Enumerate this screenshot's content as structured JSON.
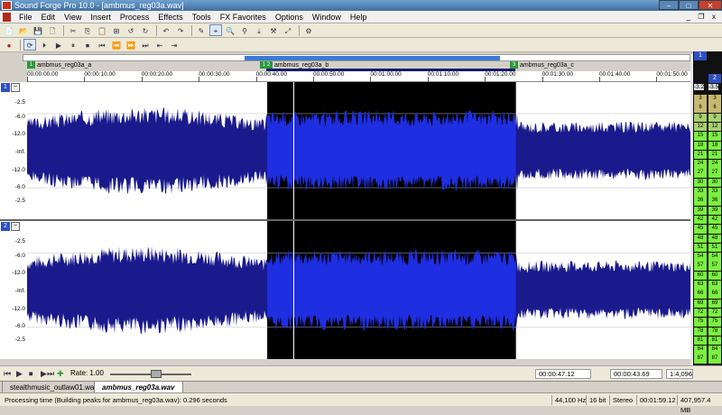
{
  "window": {
    "title": "Sound Forge Pro 10.0 - [ambmus_reg03a.wav]",
    "min": "–",
    "max": "□",
    "close": "✕"
  },
  "menu": [
    "File",
    "Edit",
    "View",
    "Insert",
    "Process",
    "Effects",
    "Tools",
    "FX Favorites",
    "Options",
    "Window",
    "Help"
  ],
  "mdi": {
    "min": "_",
    "restore": "❐",
    "close": "x"
  },
  "toolbar1": [
    "📄",
    "📂",
    "💾",
    "🗋",
    "✂",
    "⎘",
    "📋",
    "⊞",
    "↺",
    "↻",
    "↶",
    "↷",
    "✎",
    "⌖",
    "🔍",
    "⚲",
    "⤓",
    "⚒",
    "⤢",
    "⚙"
  ],
  "toolbar2": [
    "●",
    "⟳",
    "⏵",
    "▶",
    "⏸",
    "⏹",
    "⏮",
    "⏪",
    "⏩",
    "⏭",
    "⇤",
    "⇥"
  ],
  "markers": [
    {
      "id": "1",
      "label": "ambmus_reg03a_a"
    },
    {
      "id": "1 2",
      "label": "ambmus_reg03a_b"
    },
    {
      "id": "3",
      "label": "ambmus_reg03a_c"
    }
  ],
  "ruler": [
    "00:00:00.00",
    "00:00:10.00",
    "00:00:20.00",
    "00:00:30.00",
    "00:00:40.00",
    "00:00:50.00",
    "00:01:00.00",
    "00:01:10.00",
    "00:01:20.00",
    "00:01:30.00",
    "00:01:40.00",
    "00:01:50.00"
  ],
  "channels": [
    {
      "num": "1",
      "btn": "−"
    },
    {
      "num": "2",
      "btn": "−"
    }
  ],
  "db_labels": [
    "-2.5",
    "-6.0",
    "-12.0",
    "-Inf.",
    "-12.0",
    "-6.0",
    "-2.5"
  ],
  "waveform": {
    "selection_start_pct": 36.2,
    "selection_end_pct": 73.7,
    "cursor_pct": 40.2,
    "wave_color": "#1a1a8c",
    "sel_wave_color": "#1e2ee0"
  },
  "meters": {
    "heads": [
      "1",
      "2"
    ],
    "peaks": [
      "-3.2",
      "-3.5"
    ],
    "scale": [
      "3",
      "6",
      "9",
      "12",
      "15",
      "18",
      "21",
      "24",
      "27",
      "30",
      "33",
      "36",
      "39",
      "42",
      "45",
      "48",
      "51",
      "54",
      "57",
      "60",
      "63",
      "66",
      "69",
      "72",
      "75",
      "78",
      "81",
      "84",
      "87"
    ]
  },
  "transport": {
    "rate_label": "Rate: 1.00",
    "sel_start": "00:00:47.12",
    "sel_end": "00:00:43.69",
    "zoom": "1:4,096",
    "buttons": [
      "⏮",
      "▶",
      "⏹",
      "▶",
      "⏭",
      "✚"
    ]
  },
  "tabs": [
    "stealthmusic_outlaw01.wav",
    "ambmus_reg03a.wav"
  ],
  "status": {
    "message": "Processing time (Building peaks for ambmus_reg03a.wav): 0.296 seconds",
    "rate": "44,100 Hz",
    "bits": "16 bit",
    "mode": "Stereo",
    "length": "00:01:59.12",
    "size": "407,957.4 MB"
  }
}
